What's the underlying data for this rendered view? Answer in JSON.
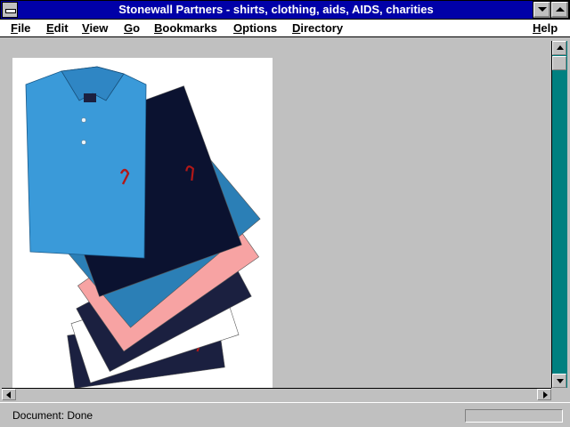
{
  "window": {
    "title": "Stonewall Partners - shirts, clothing, aids, AIDS, charities"
  },
  "menubar": {
    "items": [
      {
        "label": "File"
      },
      {
        "label": "Edit"
      },
      {
        "label": "View"
      },
      {
        "label": "Go"
      },
      {
        "label": "Bookmarks"
      },
      {
        "label": "Options"
      },
      {
        "label": "Directory"
      },
      {
        "label": "Help"
      }
    ]
  },
  "status": {
    "text": "Document: Done",
    "progress": 0
  },
  "shirts": {
    "colors": [
      "#3a9ad9",
      "#0b1230",
      "#2b7fb6",
      "#f7a3a3",
      "#1b2040",
      "#ffffff",
      "#1b2040"
    ],
    "ribbon_color": "#b21818"
  }
}
